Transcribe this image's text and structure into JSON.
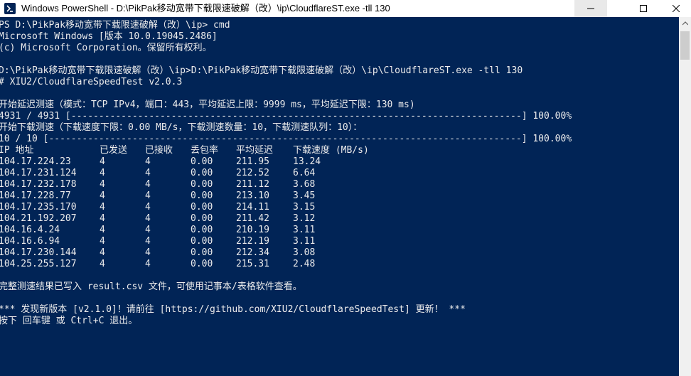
{
  "window": {
    "title": "Windows PowerShell - D:\\PikPak移动宽带下载限速破解（改）\\ip\\CloudflareST.exe  -tll 130",
    "icon": "powershell-icon",
    "buttons": [
      "minimize-icon",
      "maximize-icon",
      "close-icon"
    ]
  },
  "console": {
    "background": "#012456",
    "foreground": "#ececec",
    "lines_before": [
      "PS D:\\PikPak移动宽带下载限速破解（改）\\ip> cmd",
      "Microsoft Windows [版本 10.0.19045.2486]",
      "(c) Microsoft Corporation。保留所有权利。",
      "",
      "D:\\PikPak移动宽带下载限速破解（改）\\ip>D:\\PikPak移动宽带下载限速破解（改）\\ip\\CloudflareST.exe -tll 130",
      "# XIU2/CloudflareSpeedTest v2.0.3",
      "",
      "开始延迟测速（模式：TCP IPv4，端口：443，平均延迟上限：9999 ms，平均延迟下限：130 ms)",
      "4931 / 4931 [---------------------------------------------------------------------------------] 100.00%",
      "开始下载测速（下载速度下限：0.00 MB/s，下载测速数量：10，下载测速队列：10）：",
      "10 / 10 [-------------------------------------------------------------------------------------] 100.00%"
    ],
    "table": {
      "headers": [
        "IP 地址",
        "已发送",
        "已接收",
        "丢包率",
        "平均延迟",
        "下载速度 (MB/s)"
      ],
      "rows": [
        [
          "104.17.224.23",
          "4",
          "4",
          "0.00",
          "211.95",
          "13.24"
        ],
        [
          "104.17.231.124",
          "4",
          "4",
          "0.00",
          "212.52",
          "6.64"
        ],
        [
          "104.17.232.178",
          "4",
          "4",
          "0.00",
          "211.12",
          "3.68"
        ],
        [
          "104.17.228.77",
          "4",
          "4",
          "0.00",
          "213.10",
          "3.45"
        ],
        [
          "104.17.235.170",
          "4",
          "4",
          "0.00",
          "214.11",
          "3.15"
        ],
        [
          "104.21.192.207",
          "4",
          "4",
          "0.00",
          "211.42",
          "3.12"
        ],
        [
          "104.16.4.24",
          "4",
          "4",
          "0.00",
          "210.19",
          "3.11"
        ],
        [
          "104.16.6.94",
          "4",
          "4",
          "0.00",
          "212.19",
          "3.11"
        ],
        [
          "104.17.230.144",
          "4",
          "4",
          "0.00",
          "212.34",
          "3.08"
        ],
        [
          "104.25.255.127",
          "4",
          "4",
          "0.00",
          "215.31",
          "2.48"
        ]
      ]
    },
    "lines_after": [
      "",
      "完整测速结果已写入 result.csv 文件，可使用记事本/表格软件查看。",
      "",
      "*** 发现新版本 [v2.1.0]！请前往 [https://github.com/XIU2/CloudflareSpeedTest] 更新！ ***",
      "按下 回车键 或 Ctrl+C 退出。"
    ]
  }
}
